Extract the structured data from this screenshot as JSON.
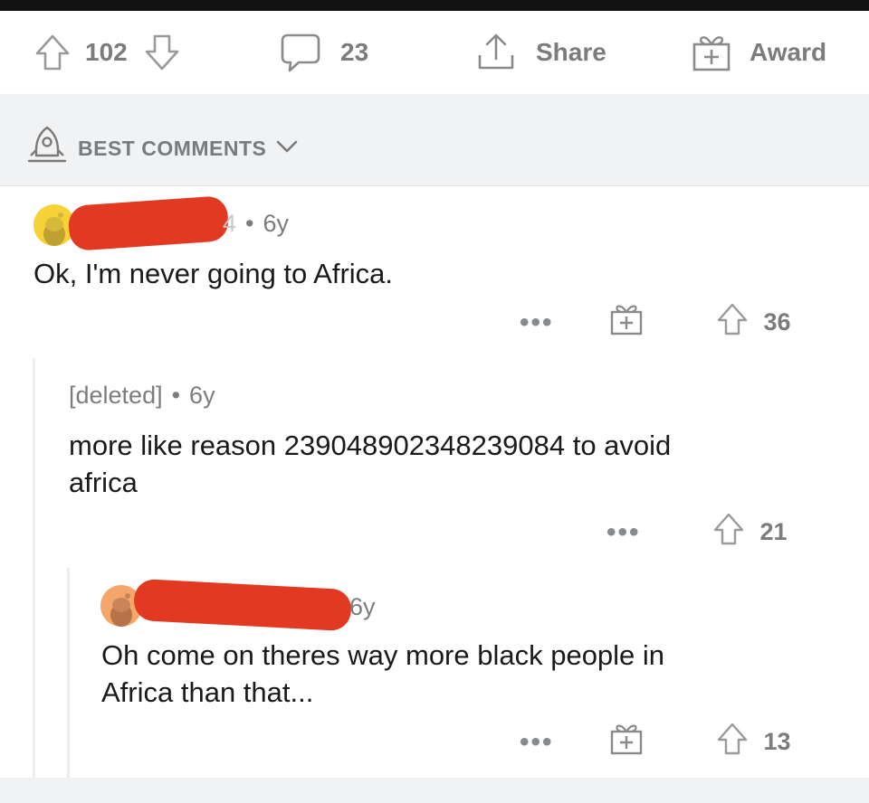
{
  "post_actions": {
    "vote_count": "102",
    "comment_count": "23",
    "share_label": "Share",
    "award_label": "Award"
  },
  "sort": {
    "label": "BEST COMMENTS"
  },
  "comments": [
    {
      "author": "[redacted]",
      "author_suffix": "4",
      "age": "6y",
      "body": "Ok, I'm never going to Africa.",
      "votes": "36",
      "avatar_color": "#f7d237"
    },
    {
      "author": "[deleted]",
      "age": "6y",
      "body_line1": "more like reason 239048902348239084 to avoid",
      "body_line2": "africa",
      "votes": "21"
    },
    {
      "author": "[redacted]",
      "age": "6y",
      "body_line1": "Oh come on theres way more black people in",
      "body_line2": "Africa than that...",
      "votes": "13",
      "avatar_color": "#f5a76b"
    }
  ],
  "colors": {
    "redaction": "#e23a22",
    "muted_text": "#7c7c7c",
    "sort_bar_bg": "#f1f2f4"
  }
}
